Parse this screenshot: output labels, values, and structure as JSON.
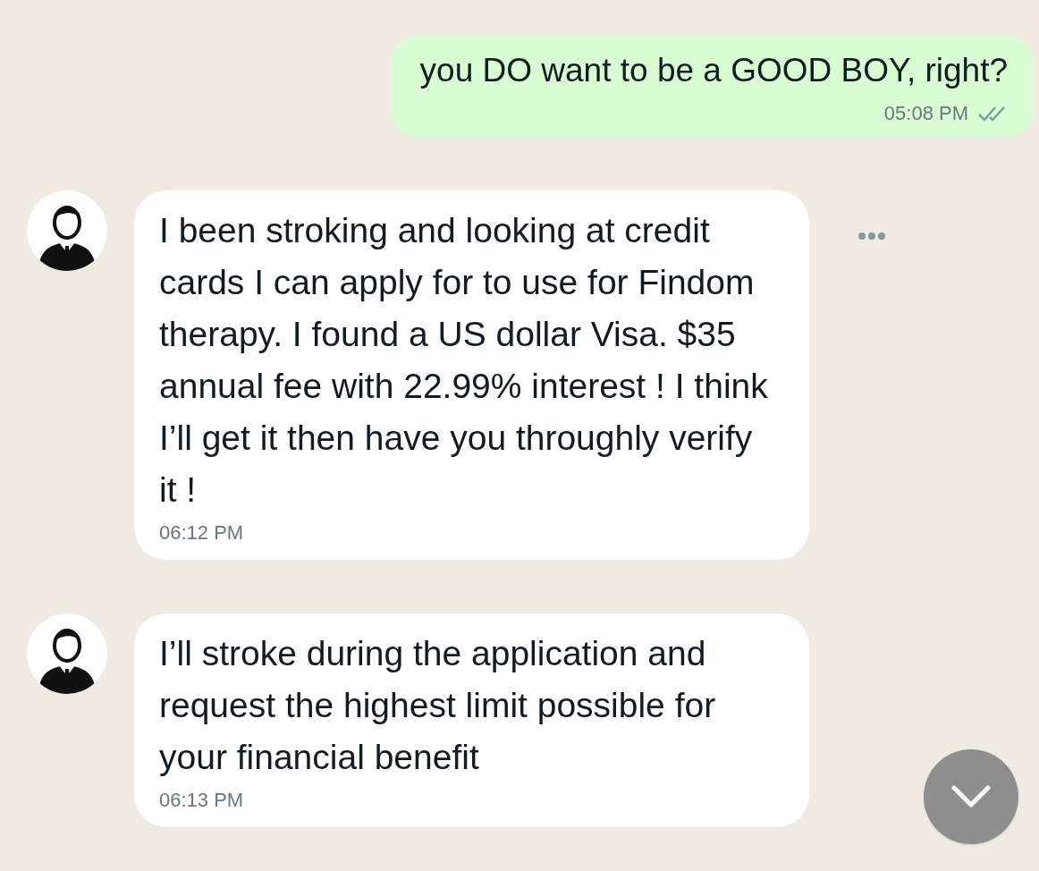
{
  "messages": [
    {
      "kind": "sent",
      "text": "you DO want to be a GOOD BOY, right?",
      "time": "05:08 PM",
      "read": false
    },
    {
      "kind": "received",
      "text": "I been stroking and looking at credit cards I can apply for to use for Findom therapy. I found a US dollar Visa. $35 annual fee with 22.99% interest ! I think I’ll get it then have you throughly verify it !",
      "time": "06:12 PM",
      "menu": true
    },
    {
      "kind": "received",
      "text": "I’ll stroke during the application and request the highest limit possible for your financial benefit",
      "time": "06:13 PM"
    }
  ],
  "scroll_down_button": true
}
